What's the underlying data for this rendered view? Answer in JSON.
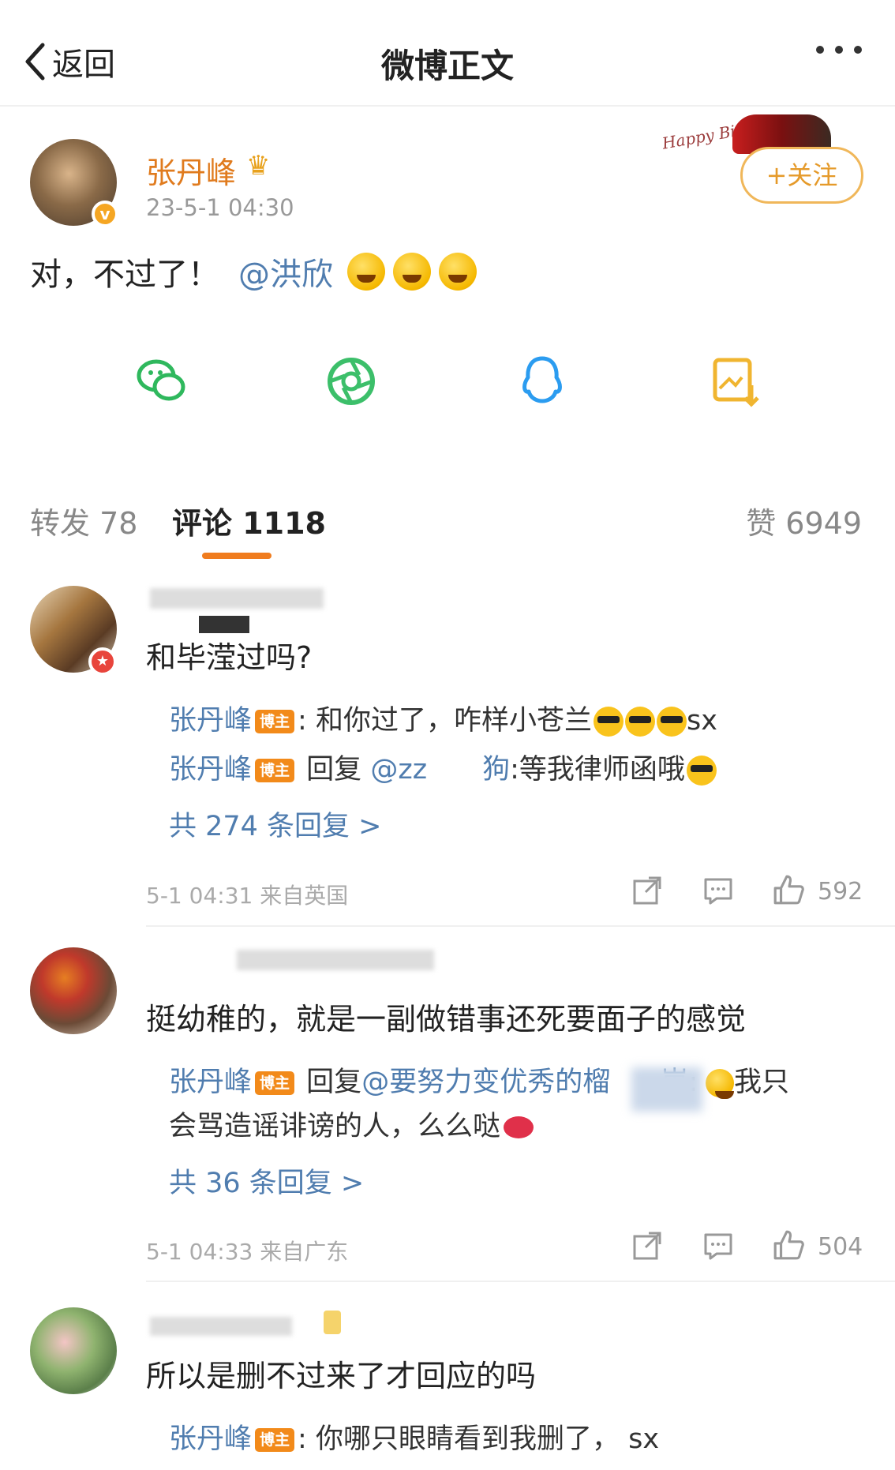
{
  "nav": {
    "back_label": "返回",
    "title": "微博正文"
  },
  "post": {
    "author": "张丹峰",
    "time": "23-5-1 04:30",
    "follow_label": "+关注",
    "birthday_badge": "Happy Birthday",
    "text": "对，不过了！",
    "mention": "@洪欣"
  },
  "share_icons": [
    "wechat-icon",
    "moments-icon",
    "qq-icon",
    "save-image-icon"
  ],
  "tabs": {
    "repost": "转发 78",
    "comments": "评论 1118",
    "likes": "赞 6949"
  },
  "colors": {
    "brand_orange": "#f07c1e",
    "link_blue": "#507daf",
    "name_orange": "#e07b1e"
  },
  "comments": [
    {
      "text": "和毕滢过吗?",
      "replies": [
        {
          "name": "张丹峰",
          "badge": "博主",
          "prefix": ":",
          "body": "和你过了，咋样小苍兰",
          "suffix": "sx"
        },
        {
          "name": "张丹峰",
          "badge": "博主",
          "prefix": "回复",
          "mention": "@zz",
          "mention_tail": "狗",
          "body": ":等我律师函哦"
        }
      ],
      "more_replies": "共 274 条回复 >",
      "meta": "5-1 04:31  来自英国",
      "likes": "592"
    },
    {
      "text": "挺幼稚的，就是一副做错事还死要面子的感觉",
      "replies": [
        {
          "name": "张丹峰",
          "badge": "博主",
          "prefix": "回复",
          "mention": "@要努力变优秀的榴",
          "mention_tail": "崽",
          "body": ":",
          "tail": "我只",
          "line2": "会骂造谣诽谤的人，么么哒"
        }
      ],
      "more_replies": "共 36 条回复 >",
      "meta": "5-1 04:33  来自广东",
      "likes": "504"
    },
    {
      "text": "所以是删不过来了才回应的吗",
      "replies": [
        {
          "name": "张丹峰",
          "badge": "博主",
          "prefix": ":",
          "body": "你哪只眼睛看到我删了，",
          "suffix": "sx"
        }
      ]
    }
  ]
}
